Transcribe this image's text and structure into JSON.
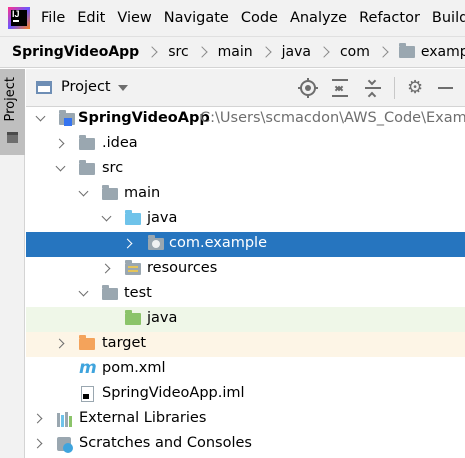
{
  "menu": {
    "items": [
      "File",
      "Edit",
      "View",
      "Navigate",
      "Code",
      "Analyze",
      "Refactor",
      "Build"
    ]
  },
  "breadcrumb": {
    "items": [
      "SpringVideoApp",
      "src",
      "main",
      "java",
      "com",
      "example"
    ]
  },
  "side": {
    "tab_label": "Project"
  },
  "panel": {
    "view_label": "Project"
  },
  "tree": {
    "root_label": "SpringVideoApp",
    "root_path": "C:\\Users\\scmacdon\\AWS_Code\\Examples",
    "idea": ".idea",
    "src": "src",
    "main": "main",
    "java_main": "java",
    "package": "com.example",
    "resources": "resources",
    "test": "test",
    "java_test": "java",
    "target": "target",
    "pom": "pom.xml",
    "iml": "SpringVideoApp.iml",
    "external_libraries": "External Libraries",
    "scratches": "Scratches and Consoles"
  },
  "colors": {
    "selection": "#2675bf",
    "test_background": "#eff7e8",
    "excluded_background": "#fdf5e6",
    "source_folder": "#6fc3ea",
    "test_folder": "#8bc46a",
    "excluded_folder": "#f4a35b"
  },
  "icons": {
    "menu_logo": "intellij-logo-icon",
    "locate": "locate-icon",
    "expand_all": "expand-all-icon",
    "collapse_all": "collapse-all-icon",
    "settings": "gear-icon",
    "hide": "minimize-icon"
  }
}
